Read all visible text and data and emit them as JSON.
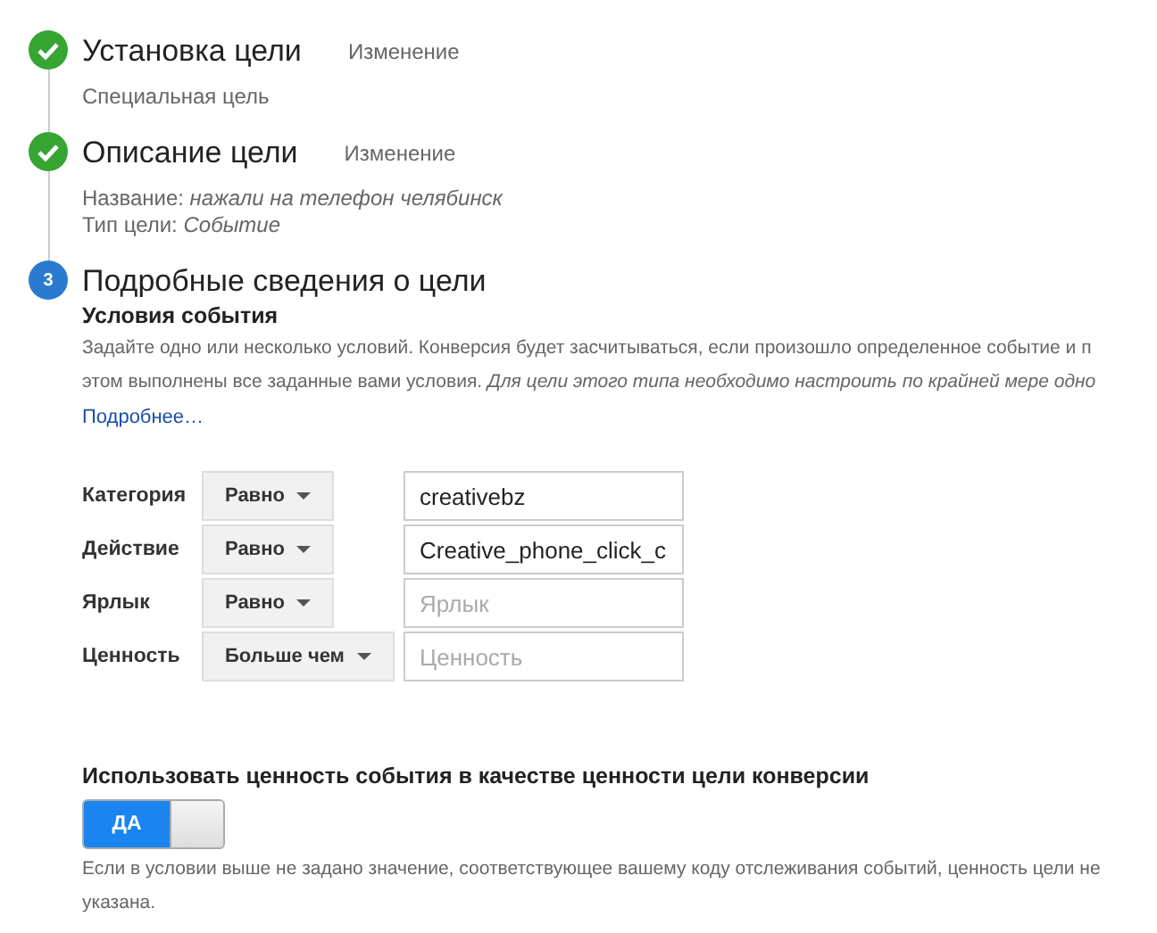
{
  "steps": [
    {
      "kind": "done",
      "title": "Установка цели",
      "edit_link": "Изменение",
      "details": [
        {
          "value": "Специальная цель"
        }
      ]
    },
    {
      "kind": "done",
      "title": "Описание цели",
      "edit_link": "Изменение",
      "details": [
        {
          "label": "Название: ",
          "value": "нажали на телефон челябинск"
        },
        {
          "label": "Тип цели: ",
          "value": "Событие"
        }
      ]
    },
    {
      "kind": "current",
      "number": "3",
      "title": "Подробные сведения о цели"
    }
  ],
  "event_conditions": {
    "heading": "Условия события",
    "description_lines": [
      "Задайте одно или несколько условий. Конверсия будет засчитываться, если произошло определенное событие и п",
      "этом выполнены все заданные вами условия. *Для цели этого типа необходимо настроить по крайней мере одно*"
    ],
    "more_link": "Подробнее…",
    "conditions": [
      {
        "label": "Категория",
        "operator": "Равно",
        "value": "creativebz"
      },
      {
        "label": "Действие",
        "operator": "Равно",
        "value": "Creative_phone_click_c"
      },
      {
        "label": "Ярлык",
        "operator": "Равно",
        "placeholder": "Ярлык"
      },
      {
        "label": "Ценность",
        "operator": "Больше чем",
        "placeholder": "Ценность"
      }
    ]
  },
  "use_event_value": {
    "heading": "Использовать ценность события в качестве ценности цели конверсии",
    "toggle_label": "ДА",
    "on": true,
    "hint_lines": [
      "Если в условии выше не задано значение, соответствующее вашему коду отслеживания событий, ценность цели не",
      "указана."
    ]
  }
}
